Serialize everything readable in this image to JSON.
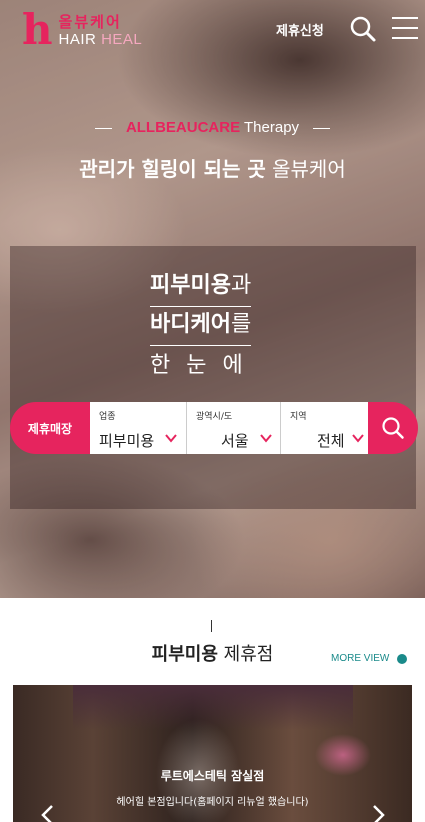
{
  "header": {
    "logo_letter": "h",
    "logo_korean": "올뷰케어",
    "logo_english_1": "HAIR",
    "logo_english_2": "HEAL",
    "partner_link": "제휴신청"
  },
  "hero": {
    "brand_pink": "ALLBEAUCARE",
    "brand_rest": "Therapy",
    "headline_bold": "관리가 힐링이 되는 곳",
    "headline_light": "올뷰케어",
    "tag1_bold": "피부미용",
    "tag1_light": "과",
    "tag2_bold": "바디케어",
    "tag2_light": "를",
    "tag3": "한눈에"
  },
  "search": {
    "category_pill": "제휴매장",
    "fields": [
      {
        "label": "업종",
        "value": "피부미용"
      },
      {
        "label": "광역시/도",
        "value": "서울"
      },
      {
        "label": "지역",
        "value": "전체"
      }
    ]
  },
  "section": {
    "title_bold": "피부미용",
    "title_light": "제휴점",
    "more_view": "MORE VIEW"
  },
  "card": {
    "title": "루트에스테틱 잠실점",
    "description": "헤어힐 본점입니다(홈페이지 리뉴얼 했습니다)"
  },
  "colors": {
    "accent": "#e6245e",
    "teal": "#1a8a8a"
  }
}
